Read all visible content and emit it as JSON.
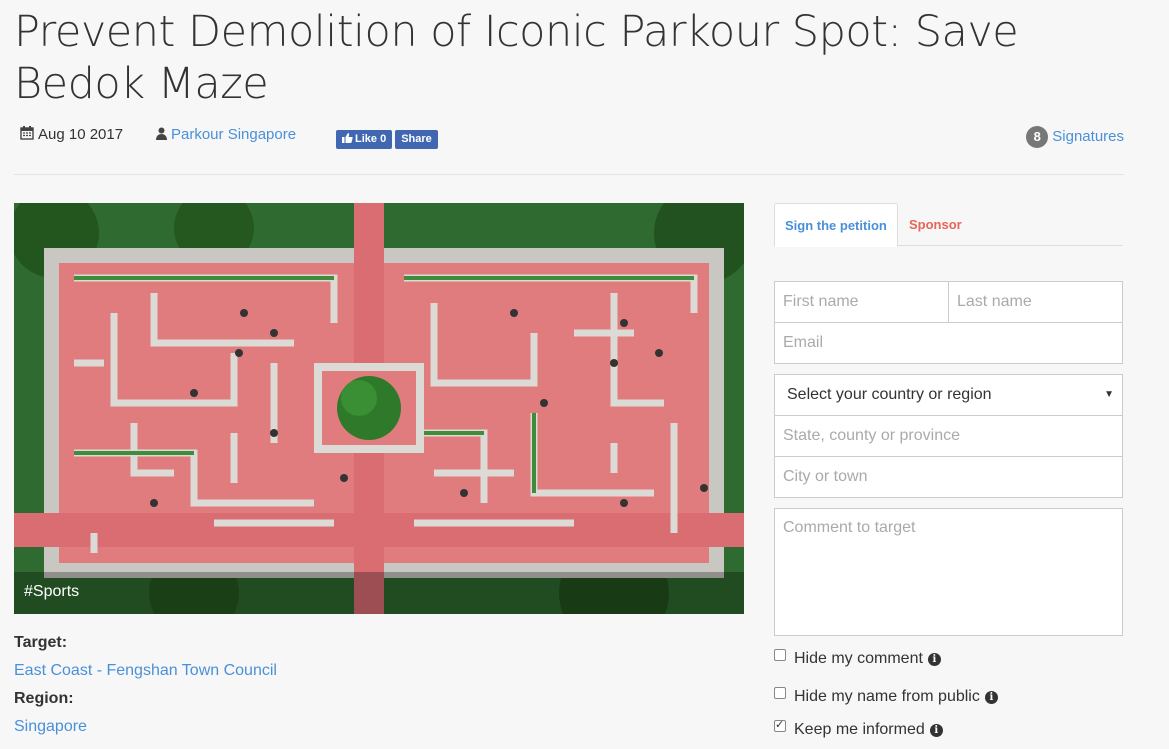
{
  "petition": {
    "title": "Prevent Demolition of Iconic Parkour Spot: Save Bedok Maze",
    "date": "Aug 10 2017",
    "author": "Parkour Singapore",
    "fb_like": "Like 0",
    "fb_share": "Share",
    "signature_count": "8",
    "signatures_label": "Signatures",
    "tag": "#Sports",
    "target_label": "Target:",
    "target_value": "East Coast - Fengshan Town Council",
    "region_label": "Region:",
    "region_value": "Singapore"
  },
  "tabs": {
    "sign": "Sign the petition",
    "sponsor": "Sponsor"
  },
  "form": {
    "first_name_placeholder": "First name",
    "last_name_placeholder": "Last name",
    "email_placeholder": "Email",
    "country_selected": "Select your country or region",
    "state_placeholder": "State, county or province",
    "city_placeholder": "City or town",
    "comment_placeholder": "Comment to target",
    "hide_comment": "Hide my comment",
    "hide_name": "Hide my name from public",
    "keep_informed": "Keep me informed",
    "hide_comment_checked": false,
    "hide_name_checked": false,
    "keep_informed_checked": true
  },
  "icons": {
    "date": "calendar-icon",
    "author": "user-icon",
    "info": "info-circle-icon",
    "dropdown": "caret-down-icon"
  },
  "colors": {
    "link": "#4a90d9",
    "sponsor": "#e8655a",
    "facebook": "#4267b2"
  }
}
